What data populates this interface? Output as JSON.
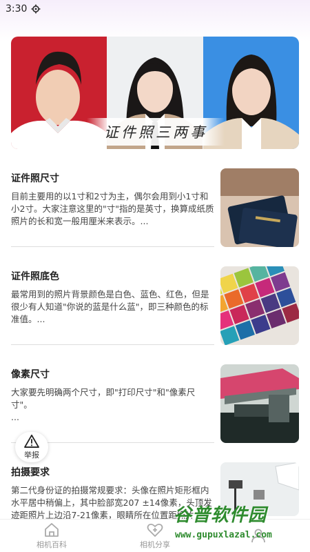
{
  "status_bar": {
    "time": "3:30"
  },
  "banner": {
    "title": "证件照三两事"
  },
  "articles": [
    {
      "title": "证件照尺寸",
      "desc": "目前主要用的以1寸和2寸为主，偶尔会用到小1寸和小2寸。大家注意这里的\"寸\"指的是英寸，换算成纸质照片的长和宽一般用厘米来表示。..."
    },
    {
      "title": "证件照底色",
      "desc": "最常用到的照片背景颜色是白色、蓝色、红色，但是很少有人知道\"你说的蓝是什么蓝\"，即三种颜色的标准值。..."
    },
    {
      "title": "像素尺寸",
      "desc": "大家要先明确两个尺寸，即\"打印尺寸\"和\"像素尺寸\"。\n..."
    },
    {
      "title": "拍摄要求",
      "desc": "第二代身份证的拍摄常规要求：头像在照片矩形框内水平居中稍偏上，其中脸部宽207 ±14像素，头顶发迹距照片上边沿7-21像素，眼睛所在位置距照片"
    }
  ],
  "report_button": {
    "label": "举报"
  },
  "tabs": [
    {
      "label": "相机百科",
      "icon": "home-icon"
    },
    {
      "label": "相机分享",
      "icon": "heart-add-icon"
    },
    {
      "label": "",
      "icon": "user-icon"
    }
  ],
  "watermark": {
    "title": "谷普软件园",
    "url": "www.gupuxlazal.com"
  }
}
